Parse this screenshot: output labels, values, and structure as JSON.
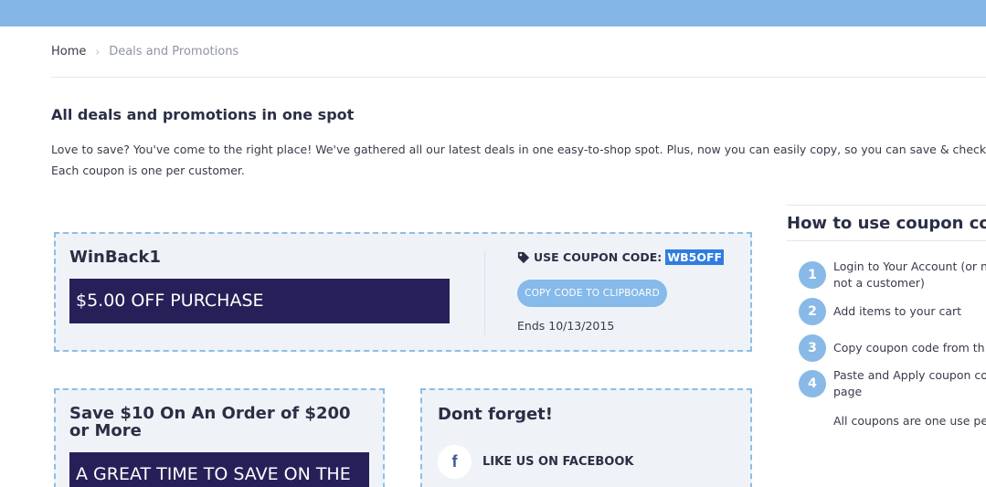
{
  "breadcrumb": {
    "home": "Home",
    "separator": "›",
    "current": "Deals and Promotions"
  },
  "page": {
    "title": "All deals and promotions in one spot",
    "intro_line1": "Love to save? You've  come to the right place! We've gathered all our latest deals in one easy-to-shop spot. Plus, now you can easily copy, so you can save & check",
    "intro_line2": "Each coupon is one per customer."
  },
  "coupon_main": {
    "name": "WinBack1",
    "banner": "$5.00 OFF PURCHASE",
    "code_label": "USE COUPON CODE:",
    "code_value": "WB5OFF",
    "copy_button": "COPY CODE TO CLIPBOARD",
    "ends": "Ends 10/13/2015"
  },
  "coupon_second": {
    "title": "Save $10 On An Order of $200 or More",
    "banner": "A GREAT TIME TO SAVE ON THE"
  },
  "social": {
    "title": "Dont forget!",
    "facebook_glyph": "f",
    "facebook_label": "LIKE US ON FACEBOOK"
  },
  "how_to": {
    "title": "How to use coupon code",
    "steps": [
      {
        "num": "1",
        "text": "Login to Your Account (or n",
        "text2": "not a customer)"
      },
      {
        "num": "2",
        "text": "Add items to your cart"
      },
      {
        "num": "3",
        "text": "Copy coupon code from th"
      },
      {
        "num": "4",
        "text": "Paste and Apply coupon co",
        "text2": "page"
      }
    ],
    "note": "All coupons are one use pe"
  },
  "colors": {
    "topbar": "#84b6e6",
    "banner": "#272058",
    "card_bg": "#eff3f8",
    "card_border": "#8dbde4",
    "button": "#86baea",
    "highlight": "#2f7de1"
  },
  "icons": {
    "tag": "tag-icon",
    "chevron": "chevron-right-icon",
    "facebook": "facebook-icon"
  }
}
